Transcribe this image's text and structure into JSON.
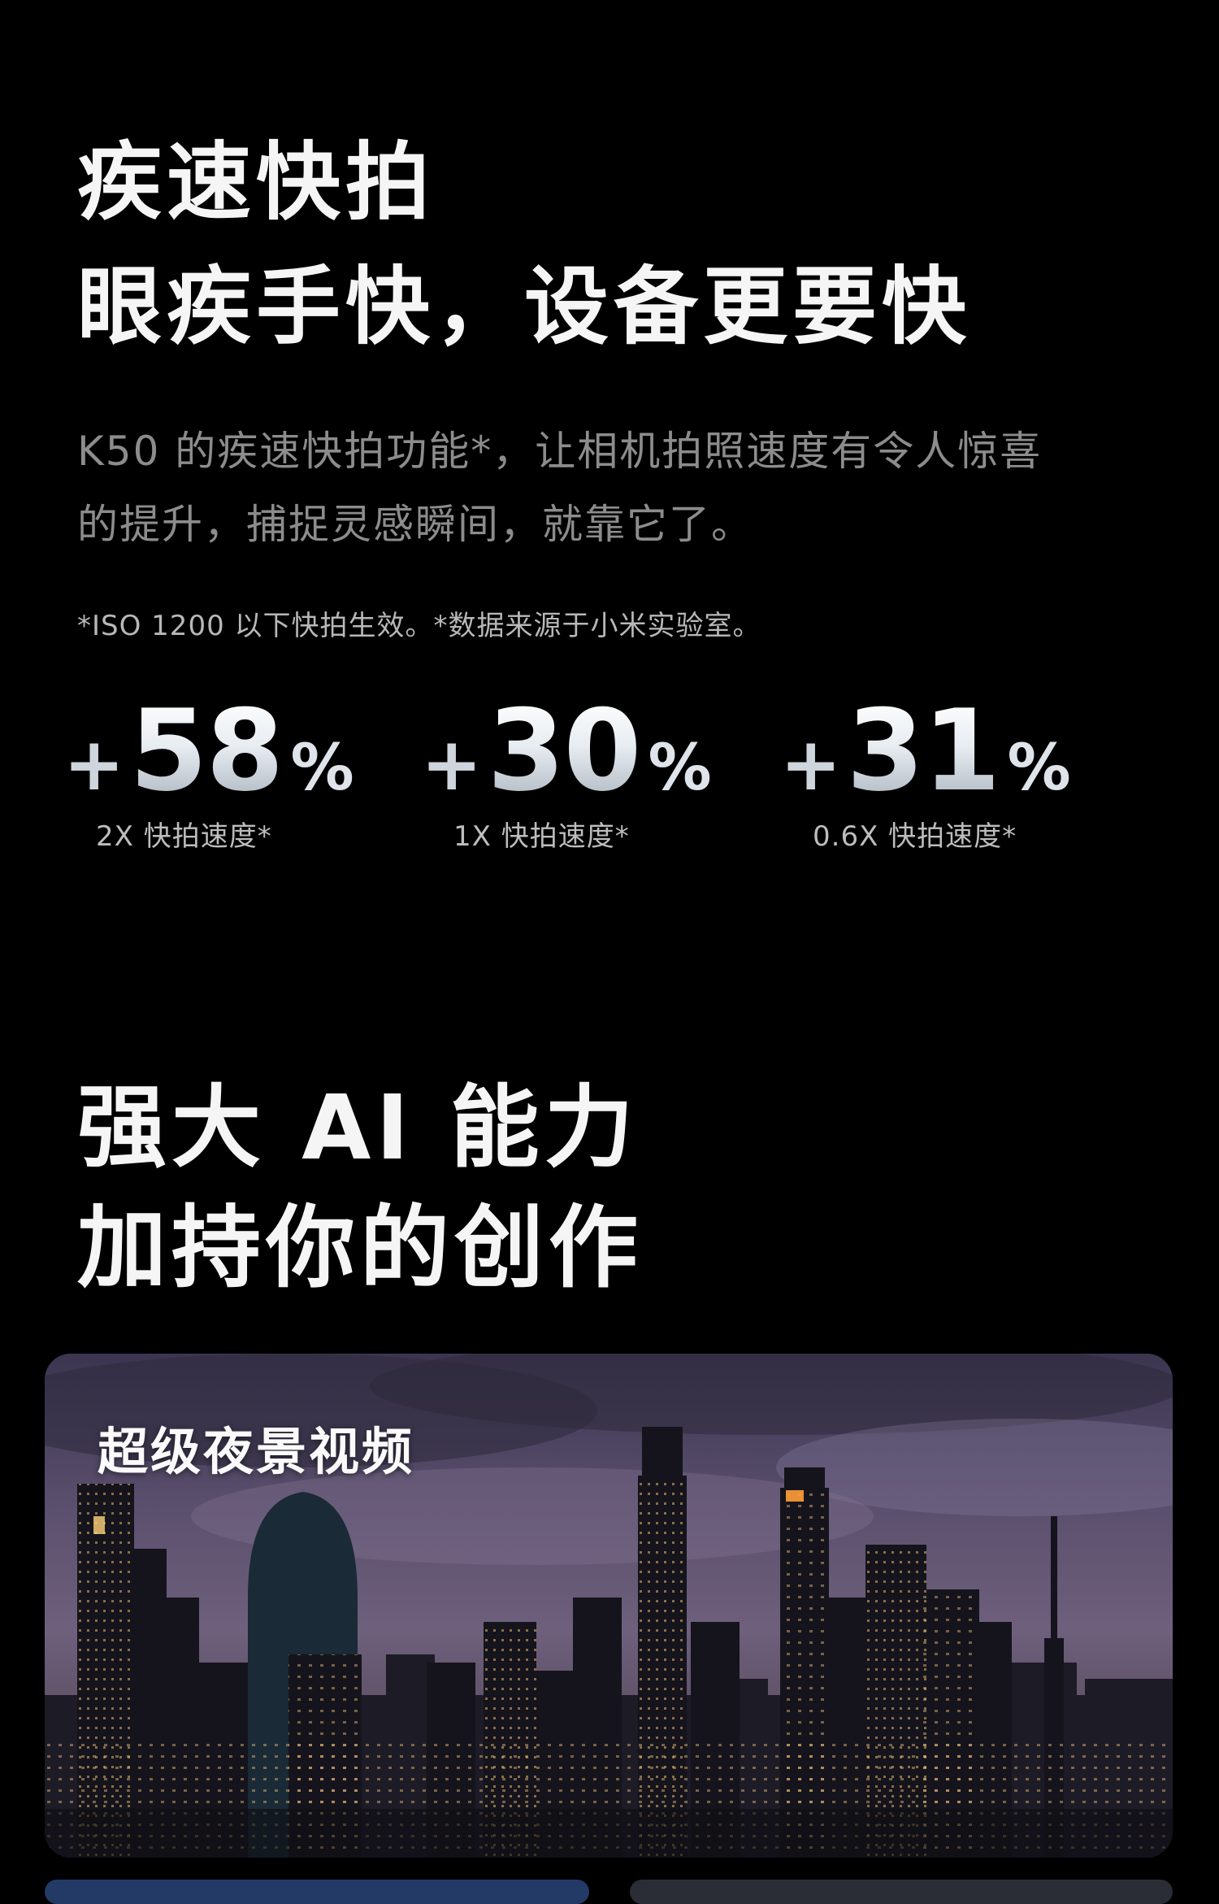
{
  "section1": {
    "title_line1": "疾速快拍",
    "title_line2": "眼疾手快，设备更要快",
    "desc_line1": "K50 的疾速快拍功能*，让相机拍照速度有令人惊喜",
    "desc_line2": "的提升，捕捉灵感瞬间，就靠它了。",
    "footnote": "*ISO 1200 以下快拍生效。*数据来源于小米实验室。"
  },
  "stats": [
    {
      "plus": "+",
      "value": "58",
      "unit": "%",
      "label": "2X 快拍速度*"
    },
    {
      "plus": "+",
      "value": "30",
      "unit": "%",
      "label": "1X 快拍速度*"
    },
    {
      "plus": "+",
      "value": "31",
      "unit": "%",
      "label": "0.6X 快拍速度*"
    }
  ],
  "section2": {
    "title_line1": "强大 AI 能力",
    "title_line2": "加持你的创作"
  },
  "card": {
    "label": "超级夜景视频"
  }
}
